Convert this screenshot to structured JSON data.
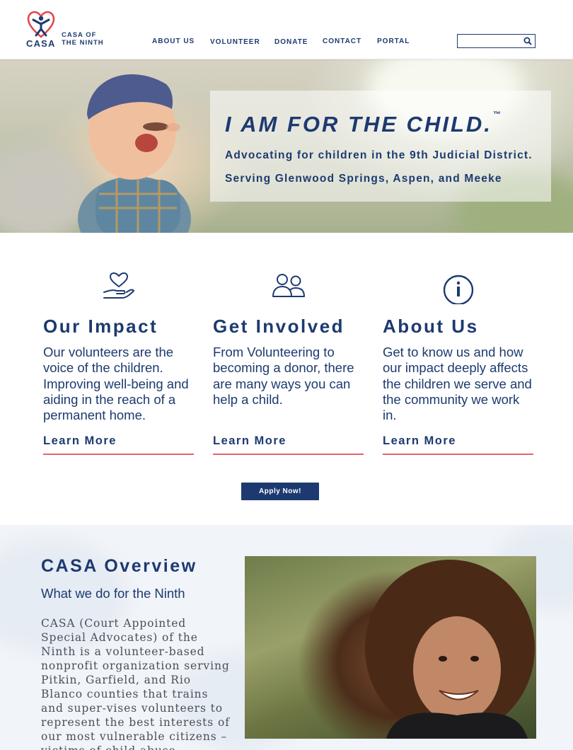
{
  "brand": {
    "logo_word": "CASA",
    "org_line1": "CASA OF",
    "org_line2": "THE NINTH",
    "accent_navy": "#1d3a70",
    "accent_red": "#e2656a"
  },
  "nav": {
    "items": [
      {
        "label": "ABOUT US"
      },
      {
        "label": "VOLUNTEER"
      },
      {
        "label": "DONATE"
      },
      {
        "label": "CONTACT"
      },
      {
        "label": "PORTAL"
      }
    ],
    "search_placeholder": "",
    "search_icon": "search-icon"
  },
  "hero": {
    "title": "I AM FOR THE CHILD.",
    "tm": "™",
    "line1": "Advocating for children in the 9th Judicial District.",
    "line2": "Serving Glenwood Springs, Aspen, and Meeke"
  },
  "cards": [
    {
      "icon": "heart-in-hand-icon",
      "title": "Our Impact",
      "text": "Our volunteers are the voice of the children. Improving well-being and aiding in the reach of a permanent home.",
      "link": "Learn More"
    },
    {
      "icon": "people-icon",
      "title": "Get Involved",
      "text": "From Volunteering to becoming a donor, there are many ways you can help a child.",
      "link": "Learn More"
    },
    {
      "icon": "info-icon",
      "title": "About Us",
      "text": "Get to know us and how our impact deeply affects the children we serve and the community we work in.",
      "link": "Learn More"
    }
  ],
  "apply": {
    "label": "Apply Now!"
  },
  "overview": {
    "title": "CASA Overview",
    "subtitle": "What we do for the Ninth",
    "body": "CASA (Court Appointed Special Advocates) of the Ninth is a volunteer-based nonprofit organization serving Pitkin, Garfield, and Rio Blanco counties that trains and super-vises volunteers to represent the best interests of our most vulnerable citizens – victims of child abuse, neglect, and"
  }
}
